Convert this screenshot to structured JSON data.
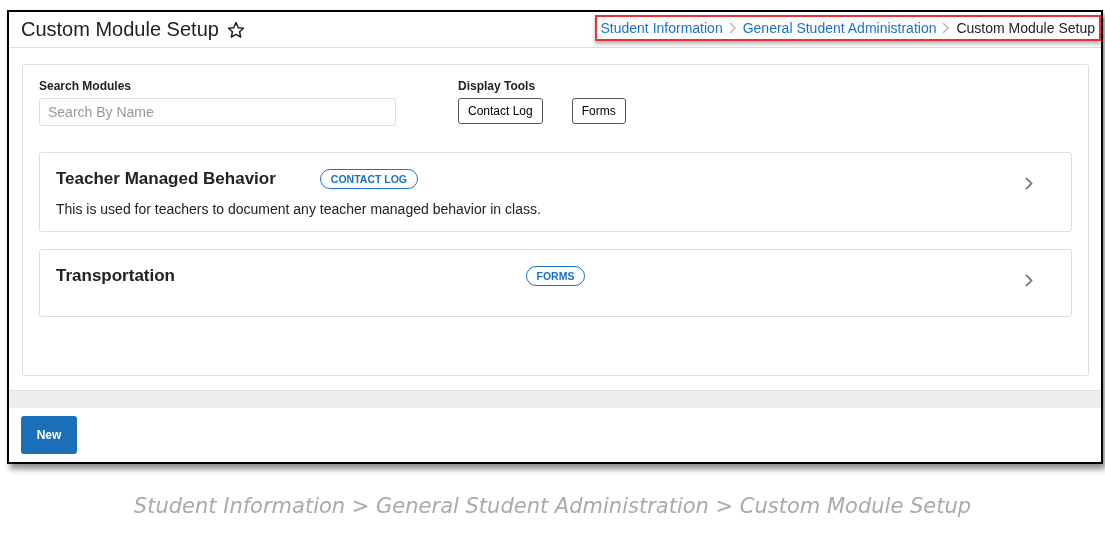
{
  "page": {
    "title": "Custom Module Setup",
    "favorite": false,
    "breadcrumb": [
      {
        "label": "Student Information",
        "link": true
      },
      {
        "label": "General Student Administration",
        "link": true
      },
      {
        "label": "Custom Module Setup",
        "link": false
      }
    ]
  },
  "search": {
    "label": "Search Modules",
    "placeholder": "Search By Name"
  },
  "display_tools": {
    "label": "Display Tools",
    "buttons": [
      "Contact Log",
      "Forms"
    ]
  },
  "modules": [
    {
      "name": "Teacher Managed Behavior",
      "tag": "CONTACT LOG",
      "description": "This is used for teachers to document any teacher managed behavior in class."
    },
    {
      "name": "Transportation",
      "tag": "FORMS"
    }
  ],
  "footer": {
    "button": "New"
  },
  "caption": "Student Information > General Student Administration > Custom Module Setup"
}
